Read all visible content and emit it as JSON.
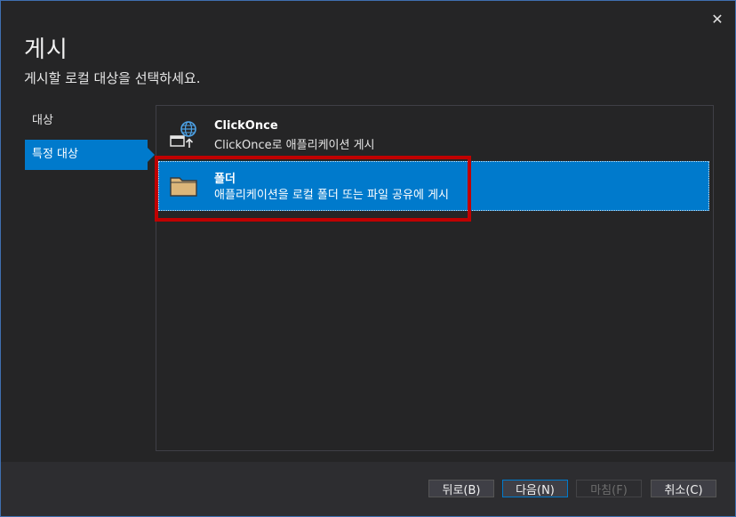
{
  "dialog": {
    "title": "게시",
    "subtitle": "게시할 로컬 대상을 선택하세요.",
    "close_glyph": "✕"
  },
  "nav": {
    "items": [
      {
        "label": "대상"
      },
      {
        "label": "특정 대상"
      }
    ]
  },
  "options": [
    {
      "title": "ClickOnce",
      "description": "ClickOnce로 애플리케이션 게시",
      "icon": "clickonce-globe-icon"
    },
    {
      "title": "폴더",
      "description": "애플리케이션을 로컬 폴더 또는 파일 공유에 게시",
      "icon": "folder-icon"
    }
  ],
  "footer": {
    "back_label": "뒤로(B)",
    "next_label": "다음(N)",
    "finish_label": "마침(F)",
    "cancel_label": "취소(C)"
  },
  "colors": {
    "accent": "#007acc",
    "highlight": "#c00000",
    "background": "#252526"
  }
}
